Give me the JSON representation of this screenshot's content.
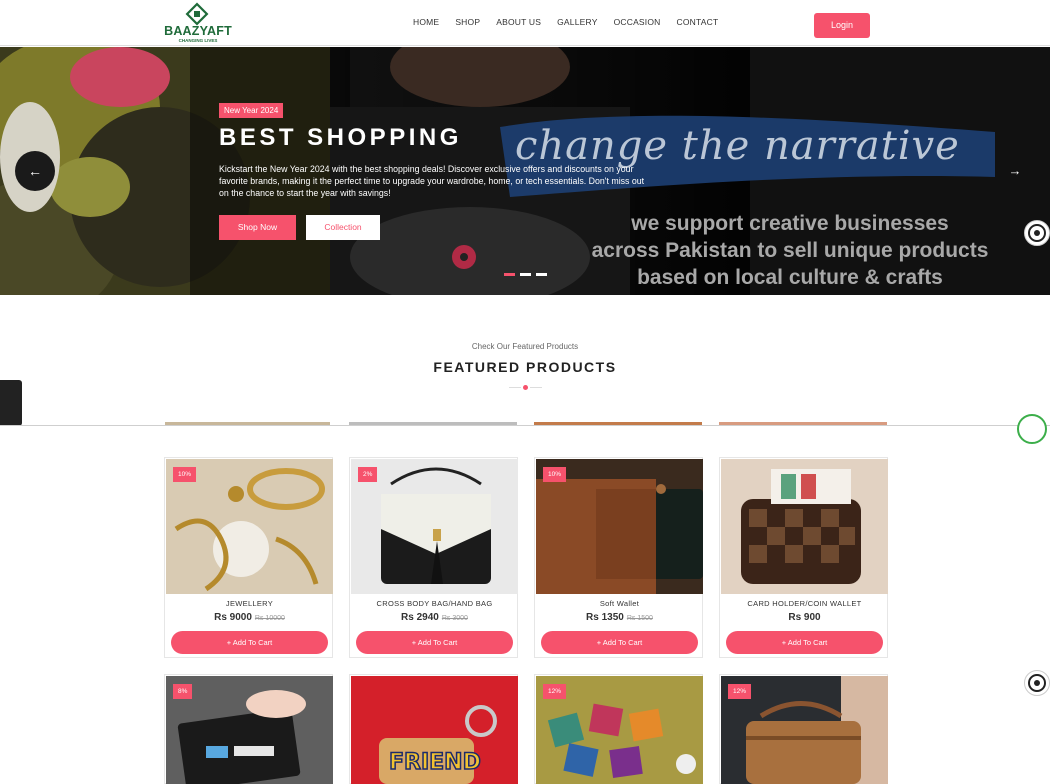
{
  "brand": {
    "name": "BAAZYAFT",
    "tagline": "CHANGING LIVES"
  },
  "nav": {
    "items": [
      "HOME",
      "SHOP",
      "ABOUT US",
      "GALLERY",
      "OCCASION",
      "CONTACT"
    ],
    "login_label": "Login"
  },
  "hero": {
    "badge": "New Year 2024",
    "title": "BEST SHOPPING",
    "description": "Kickstart the New Year 2024 with the best shopping deals! Discover exclusive offers and discounts on your favorite brands, making it the perfect time to upgrade your wardrobe, home, or tech essentials. Don't miss out on the chance to start the year with savings!",
    "shop_now_label": "Shop Now",
    "collection_label": "Collection",
    "script_text": "change the narrative",
    "slogan_lines": [
      "we support creative businesses",
      "across Pakistan to sell unique products",
      "based on local culture & crafts"
    ],
    "prev_icon": "arrow-left-icon",
    "next_icon": "arrow-right-icon"
  },
  "featured": {
    "subtitle": "Check Our Featured Products",
    "title": "FEATURED PRODUCTS"
  },
  "products": [
    {
      "name": "JEWELLERY",
      "price": "Rs 9000",
      "old_price": "Rs 10000",
      "discount": "10%",
      "cart_label": "+ Add To Cart"
    },
    {
      "name": "CROSS BODY BAG/HAND BAG",
      "price": "Rs 2940",
      "old_price": "Rs 3000",
      "discount": "2%",
      "cart_label": "+ Add To Cart"
    },
    {
      "name": "Soft Wallet",
      "price": "Rs 1350",
      "old_price": "Rs 1500",
      "discount": "10%",
      "cart_label": "+ Add To Cart"
    },
    {
      "name": "CARD HOLDER/COIN WALLET",
      "price": "Rs 900",
      "old_price": "",
      "discount": "",
      "cart_label": "+ Add To Cart"
    },
    {
      "name": "",
      "price": "",
      "old_price": "",
      "discount": "8%",
      "cart_label": ""
    },
    {
      "name": "",
      "price": "",
      "old_price": "",
      "discount": "",
      "cart_label": ""
    },
    {
      "name": "",
      "price": "",
      "old_price": "",
      "discount": "12%",
      "cart_label": ""
    },
    {
      "name": "",
      "price": "",
      "old_price": "",
      "discount": "12%",
      "cart_label": ""
    }
  ],
  "colors": {
    "accent": "#f6526c",
    "brand_green": "#1f6b3a",
    "hero_bg": "#0b0b0b"
  }
}
